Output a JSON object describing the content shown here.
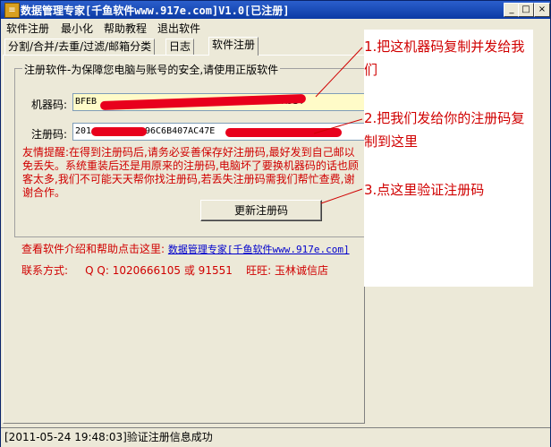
{
  "window": {
    "title": "数据管理专家[千鱼软件www.917e.com]V1.0[已注册]",
    "icon": "app-icon",
    "controls": [
      "minimize-icon",
      "maximize-icon",
      "close-icon"
    ]
  },
  "menu": [
    "软件注册",
    "最小化",
    "帮助教程",
    "退出软件"
  ],
  "tabs": [
    "分割/合并/去重/过滤/邮箱分类",
    "日志",
    "软件注册"
  ],
  "register": {
    "group_title": "注册软件-为保障您电脑与账号的安全,请使用正版软件",
    "machine_label": "机器码:",
    "machine_code": "BFEB",
    "machine_code_tail": "A314",
    "reg_label": "注册码:",
    "reg_code": "201",
    "reg_code_mid": "96C6B407AC47E",
    "notice": "友情提醒:在得到注册码后,请务必妥善保存好注册码,最好发到自己邮以免丢失。系统重装后还是用原来的注册码,电脑坏了要换机器码的话也顾客太多,我们不可能天天帮你找注册码,若丢失注册码需我们帮忙查费,谢谢合作。",
    "update_button": "更新注册码"
  },
  "help": {
    "prefix": "查看软件介绍和帮助点击这里:",
    "link": "数据管理专家[千鱼软件www.917e.com]"
  },
  "contact": {
    "label": "联系方式:",
    "qq_label": "Q Q:",
    "qq": "1020666105 或 91551",
    "wangwang_label": "旺旺:",
    "wangwang": "玉林诚信店"
  },
  "status": "[2011-05-24 19:48:03]验证注册信息成功",
  "annotations": [
    "1.把这机器码复制并发给我们",
    "2.把我们发给你的注册码复制到这里",
    "3.点这里验证注册码"
  ],
  "colors": {
    "title_bar": "#0b3aa4",
    "notice_text": "#d00000",
    "link": "#0000cc",
    "machine_field_bg": "#fffbc8",
    "reg_field_bg": "#ffffff"
  }
}
